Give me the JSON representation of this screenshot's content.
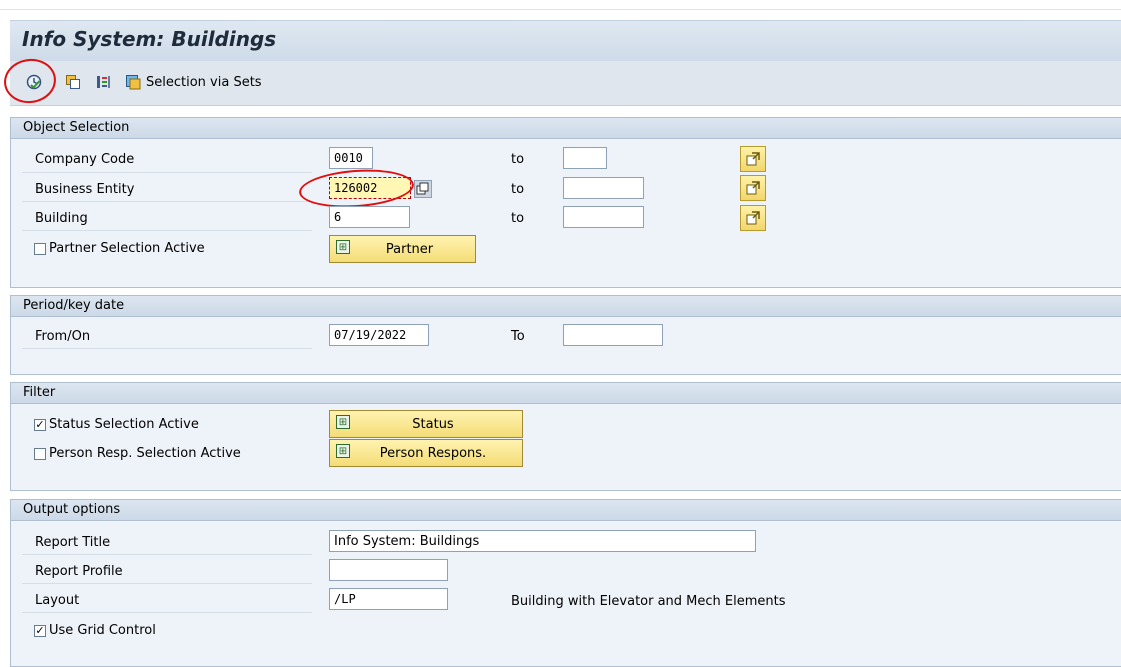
{
  "title": "Info System: Buildings",
  "toolbar": {
    "execute_icon": "execute-clock-check-icon",
    "icons": [
      "copy-variant-icon",
      "display-fields-icon",
      "selection-sets-icon"
    ],
    "selection_via_sets": "Selection via Sets"
  },
  "object_selection": {
    "heading": "Object Selection",
    "company_code": {
      "label": "Company Code",
      "from": "0010",
      "to_label": "to",
      "to": ""
    },
    "business_entity": {
      "label": "Business Entity",
      "from": "126002",
      "to_label": "to",
      "to": ""
    },
    "building": {
      "label": "Building",
      "from": "6",
      "to_label": "to",
      "to": ""
    },
    "partner_selection": {
      "label": "Partner Selection Active",
      "checked": false,
      "button": "Partner"
    }
  },
  "period": {
    "heading": "Period/key date",
    "from_label": "From/On",
    "from": "07/19/2022",
    "to_label": "To",
    "to": ""
  },
  "filter": {
    "heading": "Filter",
    "status": {
      "label": "Status Selection Active",
      "checked": true,
      "check_glyph": "✓",
      "button": "Status"
    },
    "person": {
      "label": "Person Resp. Selection Active",
      "checked": false,
      "check_glyph": "",
      "button": "Person Respons."
    }
  },
  "output": {
    "heading": "Output options",
    "report_title": {
      "label": "Report Title",
      "value": "Info System: Buildings"
    },
    "report_profile": {
      "label": "Report Profile",
      "value": ""
    },
    "layout": {
      "label": "Layout",
      "value": "/LP",
      "description": "Building with Elevator and Mech Elements"
    },
    "grid": {
      "label": "Use Grid Control",
      "checked": true,
      "check_glyph": "✓"
    }
  },
  "colors": {
    "frame_bg": "#eef3f9",
    "button_yellow": "#f4dc76",
    "annotation_red": "#e01010"
  }
}
